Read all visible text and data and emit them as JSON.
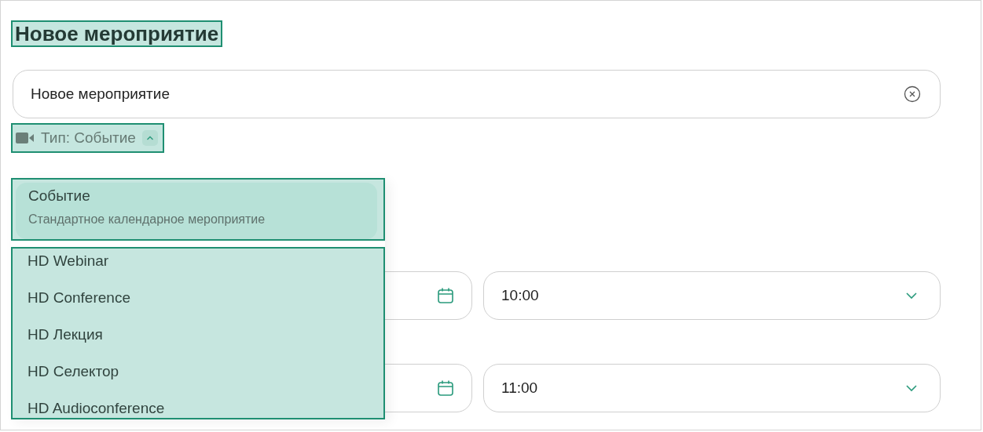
{
  "title": "Новое мероприятие",
  "name_field": {
    "value": "Новое мероприятие"
  },
  "type_selector": {
    "label": "Тип: Событие",
    "expanded": true
  },
  "type_menu": [
    {
      "name": "Событие",
      "description": "Стандартное календарное мероприятие",
      "selected": true
    },
    {
      "name": "HD Webinar",
      "selected": false
    },
    {
      "name": "HD Conference",
      "selected": false
    },
    {
      "name": "HD Лекция",
      "selected": false
    },
    {
      "name": "HD Селектор",
      "selected": false
    },
    {
      "name": "HD Audioconference",
      "selected": false
    }
  ],
  "schedule": [
    {
      "time": "10:00"
    },
    {
      "time": "11:00"
    }
  ]
}
